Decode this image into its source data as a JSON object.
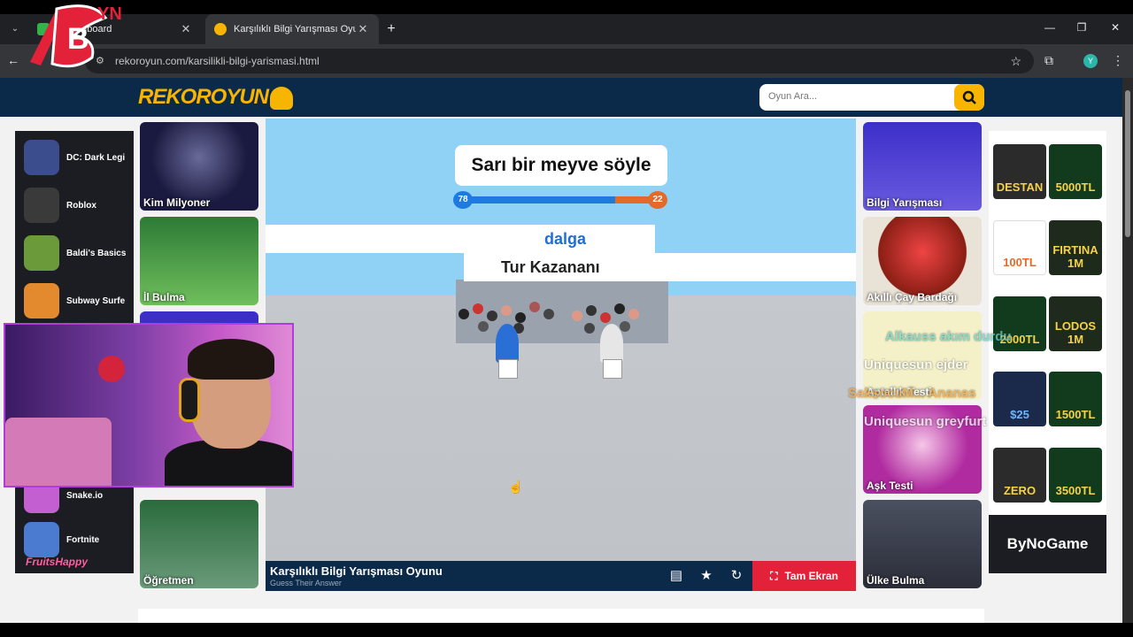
{
  "browser": {
    "tabs": [
      {
        "title": "k Dashboard",
        "close": "✕"
      },
      {
        "title": "Karşılıklı Bilgi Yarışması Oyunu",
        "close": "✕"
      }
    ],
    "new_tab": "+",
    "url": "rekoroyun.com/karsilikli-bilgi-yarismasi.html",
    "profile_initial": "Y",
    "window_controls": [
      "—",
      "❐",
      "✕"
    ]
  },
  "site": {
    "logo": "REKOROYUN",
    "search_placeholder": "Oyun Ara..."
  },
  "left_ad": {
    "items": [
      {
        "label": "DC: Dark Legi",
        "color": "#3b4d8c"
      },
      {
        "label": "Roblox",
        "color": "#3a3a3a"
      },
      {
        "label": "Baldi's Basics",
        "color": "#6a9a3a"
      },
      {
        "label": "Subway Surfe",
        "color": "#e28a2d"
      },
      {
        "label": "Snake.io",
        "color": "#c45fd1"
      },
      {
        "label": "Fortnite",
        "color": "#4a7bd1"
      }
    ],
    "brand": "FruitsHappy"
  },
  "left_thumbs": [
    {
      "caption": "Kim Milyoner",
      "color": "#1a1a40"
    },
    {
      "caption": "İl Bulma",
      "color": "#2d7a36"
    },
    {
      "caption": "Öğretmen",
      "color": "#2a6b3c"
    }
  ],
  "right_thumbs": [
    {
      "caption": "Bilgi Yarışması",
      "color": "#3c2fc8"
    },
    {
      "caption": "Akıllı Çay Bardağı",
      "color": "#b42a1e"
    },
    {
      "caption": "Aptallık Testi",
      "color": "#f4f1c9"
    },
    {
      "caption": "Aşk Testi",
      "color": "#b02aa0"
    },
    {
      "caption": "Ülke Bulma",
      "color": "#2b2e39"
    }
  ],
  "game": {
    "question": "Sarı bir meyve söyle",
    "score_left": "78",
    "score_right": "22",
    "progress_left_fraction": 0.78,
    "answer_word": "dalga",
    "round_label": "Tur Kazananı",
    "title": "Karşılıklı Bilgi Yarışması Oyunu",
    "subtitle": "Guess Their Answer",
    "fullscreen_label": "Tam Ekran",
    "colors": {
      "blue": "#1f7ae0",
      "orange": "#e36a2b"
    }
  },
  "right_ad": {
    "cards": [
      {
        "label": "DESTAN",
        "bg": "#2b2b2b"
      },
      {
        "label": "5000TL",
        "bg": "#123b1e"
      },
      {
        "label": "100TL",
        "bg": "#ffffff"
      },
      {
        "label": "FIRTINA 1M",
        "bg": "#1e2b1c"
      },
      {
        "label": "2000TL",
        "bg": "#123b1e"
      },
      {
        "label": "LODOS 1M",
        "bg": "#1e2b1c"
      },
      {
        "label": "$25",
        "bg": "#1b2a4a"
      },
      {
        "label": "1500TL",
        "bg": "#123b1e"
      },
      {
        "label": "ZERO",
        "bg": "#2b2b2b"
      },
      {
        "label": "3500TL",
        "bg": "#123b1e"
      }
    ],
    "brand": "ByNoGame"
  },
  "chat_overlay": [
    {
      "text": "Alkauss  akım durdu",
      "color": "#6ad6c4"
    },
    {
      "text": "Uniquesun  ejder",
      "color": "#ffffff"
    },
    {
      "text": "SaksocuM...  Ananas",
      "color": "#f1a33a"
    },
    {
      "text": "Uniquesun  greyfurt",
      "color": "#ffffff"
    }
  ]
}
